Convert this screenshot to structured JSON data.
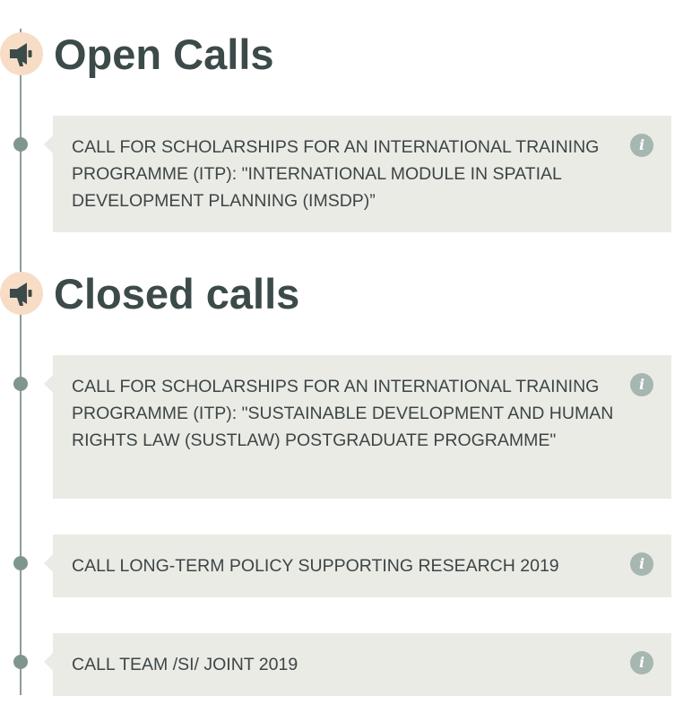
{
  "colors": {
    "timeline": "#8a9e97",
    "timeline_dot": "#7f968f",
    "megaphone_bg": "#f7dcc6",
    "heading": "#3c4a4a",
    "card_bg": "#ebebe6",
    "card_text": "#3c4646",
    "info_icon_bg": "#a6b6b0"
  },
  "icons": {
    "section": "megaphone-icon",
    "item_action": "info-icon",
    "timeline_marker": "timeline-dot"
  },
  "open_calls": {
    "title": "Open Calls",
    "items": [
      {
        "text": "CALL FOR SCHOLARSHIPS FOR AN INTERNATIONAL TRAINING PROGRAMME (ITP): \"INTERNATIONAL MODULE IN SPATIAL DEVELOPMENT PLANNING (IMSDP)”",
        "info": "i"
      }
    ]
  },
  "closed_calls": {
    "title": "Closed calls",
    "items": [
      {
        "text": "CALL FOR SCHOLARSHIPS FOR AN INTERNATIONAL TRAINING PROGRAMME (ITP): \"SUSTAINABLE DEVELOPMENT AND HUMAN RIGHTS LAW (SUSTLAW) POSTGRADUATE PROGRAMME\"",
        "info": "i"
      },
      {
        "text": "CALL LONG-TERM POLICY SUPPORTING RESEARCH 2019",
        "info": "i"
      },
      {
        "text": "CALL TEAM /SI/ JOINT 2019",
        "info": "i"
      }
    ]
  }
}
